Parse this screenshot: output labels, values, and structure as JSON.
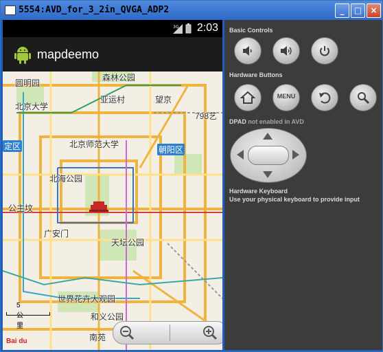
{
  "window": {
    "title": "5554:AVD_for_3_2in_QVGA_ADP2",
    "controls": {
      "minimize": "_",
      "maximize": "□",
      "close": "×"
    }
  },
  "statusbar": {
    "network": "3G",
    "time": "2:03"
  },
  "app": {
    "title": "mapdeemo",
    "icon": "android-robot-icon"
  },
  "map": {
    "labels": [
      "森林公园",
      "圆明园",
      "亚运村",
      "望京",
      "北京大学",
      "798艺",
      "北京师范大学",
      "定区",
      "朝阳区",
      "北海公园",
      "公主坟",
      "广安门",
      "天坛公园",
      "世界花卉大观园",
      "和义公园",
      "南苑"
    ],
    "scale_label": "5公里",
    "brand": "Bai du",
    "zoom_out_icon": "zoom-out-icon",
    "zoom_in_icon": "zoom-in-icon"
  },
  "panel": {
    "basic_controls": "Basic Controls",
    "hardware_buttons": "Hardware Buttons",
    "menu_label": "MENU",
    "dpad_title": "DPAD",
    "dpad_note": " not enabled in AVD",
    "keyboard_title": "Hardware Keyboard",
    "keyboard_note": "Use your physical keyboard to provide input"
  }
}
